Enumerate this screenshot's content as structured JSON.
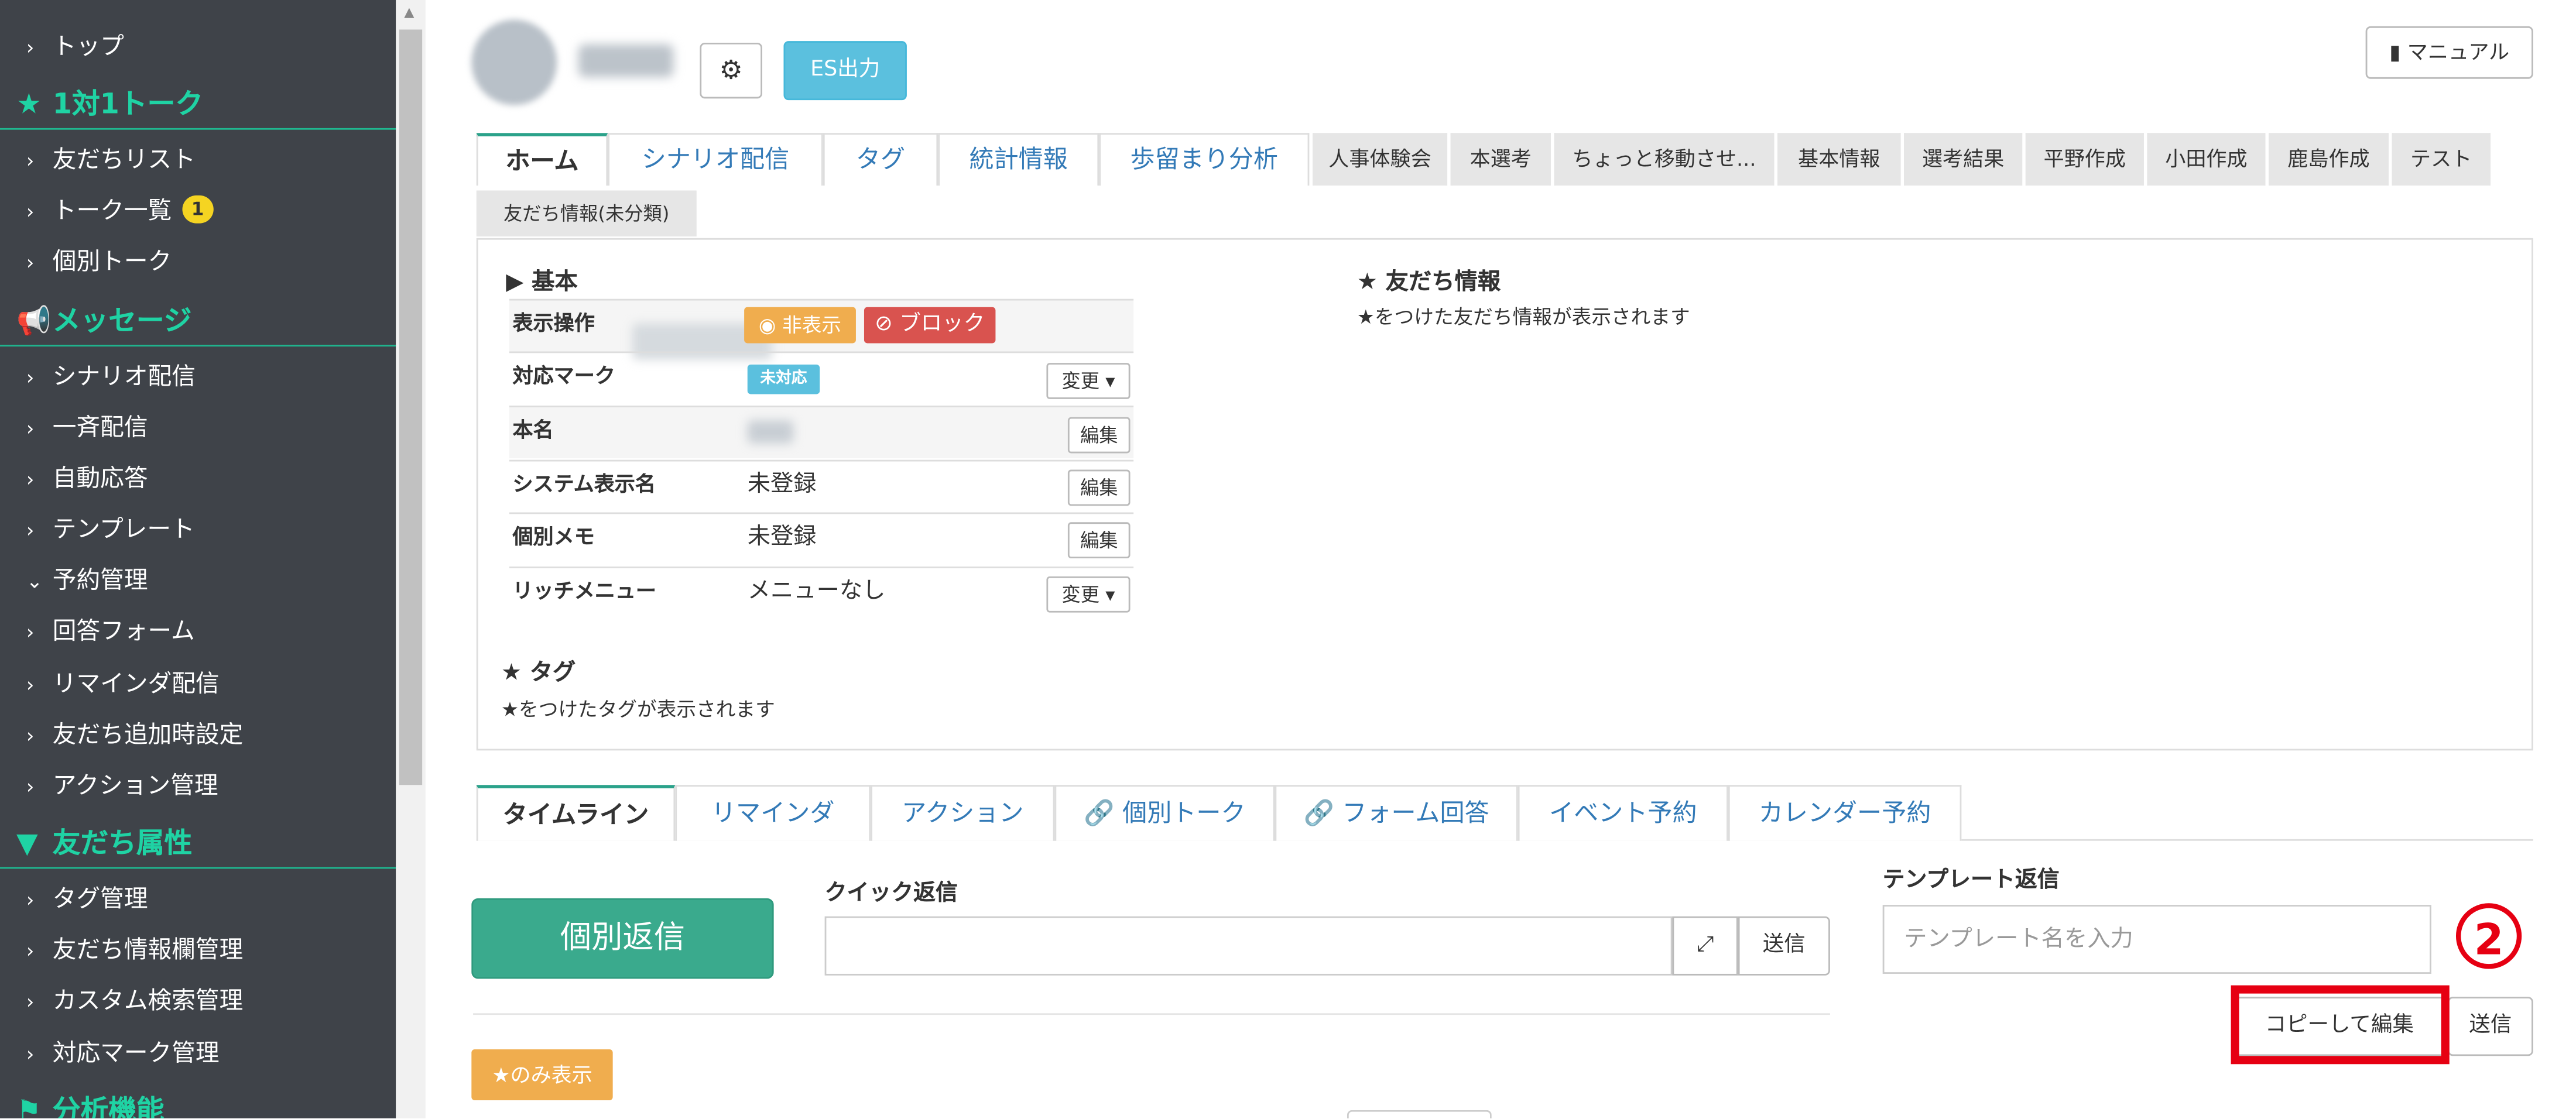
{
  "sidebar": {
    "items": [
      {
        "label": "トップ"
      },
      {
        "label": "友だちリスト"
      },
      {
        "label": "トーク一覧",
        "badge": "1"
      },
      {
        "label": "個別トーク"
      },
      {
        "label": "シナリオ配信"
      },
      {
        "label": "一斉配信"
      },
      {
        "label": "自動応答"
      },
      {
        "label": "テンプレート"
      },
      {
        "label": "予約管理"
      },
      {
        "label": "回答フォーム"
      },
      {
        "label": "リマインダ配信"
      },
      {
        "label": "友だち追加時設定"
      },
      {
        "label": "アクション管理"
      },
      {
        "label": "タグ管理"
      },
      {
        "label": "友だち情報欄管理"
      },
      {
        "label": "カスタム検索管理"
      },
      {
        "label": "対応マーク管理"
      }
    ],
    "sections": [
      {
        "label": "1対1トーク",
        "icon": "star-icon"
      },
      {
        "label": "メッセージ",
        "icon": "megaphone-icon"
      },
      {
        "label": "友だち属性",
        "icon": "filter-icon"
      },
      {
        "label": "分析機能",
        "icon": "flag-icon"
      }
    ]
  },
  "header": {
    "es_button": "ES出力",
    "manual_button": "マニュアル"
  },
  "tabs": [
    {
      "label": "ホーム"
    },
    {
      "label": "シナリオ配信"
    },
    {
      "label": "タグ"
    },
    {
      "label": "統計情報"
    },
    {
      "label": "歩留まり分析"
    },
    {
      "label": "人事体験会"
    },
    {
      "label": "本選考"
    },
    {
      "label": "ちょっと移動させ..."
    },
    {
      "label": "基本情報"
    },
    {
      "label": "選考結果"
    },
    {
      "label": "平野作成"
    },
    {
      "label": "小田作成"
    },
    {
      "label": "鹿島作成"
    },
    {
      "label": "テスト"
    }
  ],
  "subtab": "友だち情報(未分類)",
  "basic": {
    "title": "基本",
    "rows": [
      {
        "key": "表示操作"
      },
      {
        "key": "対応マーク"
      },
      {
        "key": "本名"
      },
      {
        "key": "システム表示名",
        "value": "未登録"
      },
      {
        "key": "個別メモ",
        "value": "未登録"
      },
      {
        "key": "リッチメニュー",
        "value": "メニューなし"
      }
    ],
    "hide_button": "非表示",
    "block_button": "ブロック",
    "unhandled_label": "未対応",
    "change_label": "変更",
    "edit_label": "編集"
  },
  "friend_info": {
    "title": "友だち情報",
    "note": "★をつけた友だち情報が表示されます"
  },
  "tag_section": {
    "title": "タグ",
    "note": "★をつけたタグが表示されます"
  },
  "timeline_tabs": [
    {
      "label": "タイムライン"
    },
    {
      "label": "リマインダ"
    },
    {
      "label": "アクション"
    },
    {
      "label": "個別トーク"
    },
    {
      "label": "フォーム回答"
    },
    {
      "label": "イベント予約"
    },
    {
      "label": "カレンダー予約"
    }
  ],
  "reply": {
    "individual_button": "個別返信",
    "quick_title": "クイック返信",
    "send": "送信",
    "template_title": "テンプレート返信",
    "template_placeholder": "テンプレート名を入力",
    "copy_edit": "コピーして編集",
    "star_only": "★のみ表示"
  },
  "annotation": {
    "number": "②",
    "color": "#e60012"
  },
  "colors": {
    "sidebar_bg": "#3f4349",
    "accent_green": "#1fd3a4",
    "tab_active_border": "#2ba28a",
    "info_blue": "#5bc0de",
    "warning": "#f0ad4e",
    "danger": "#d9534f"
  }
}
